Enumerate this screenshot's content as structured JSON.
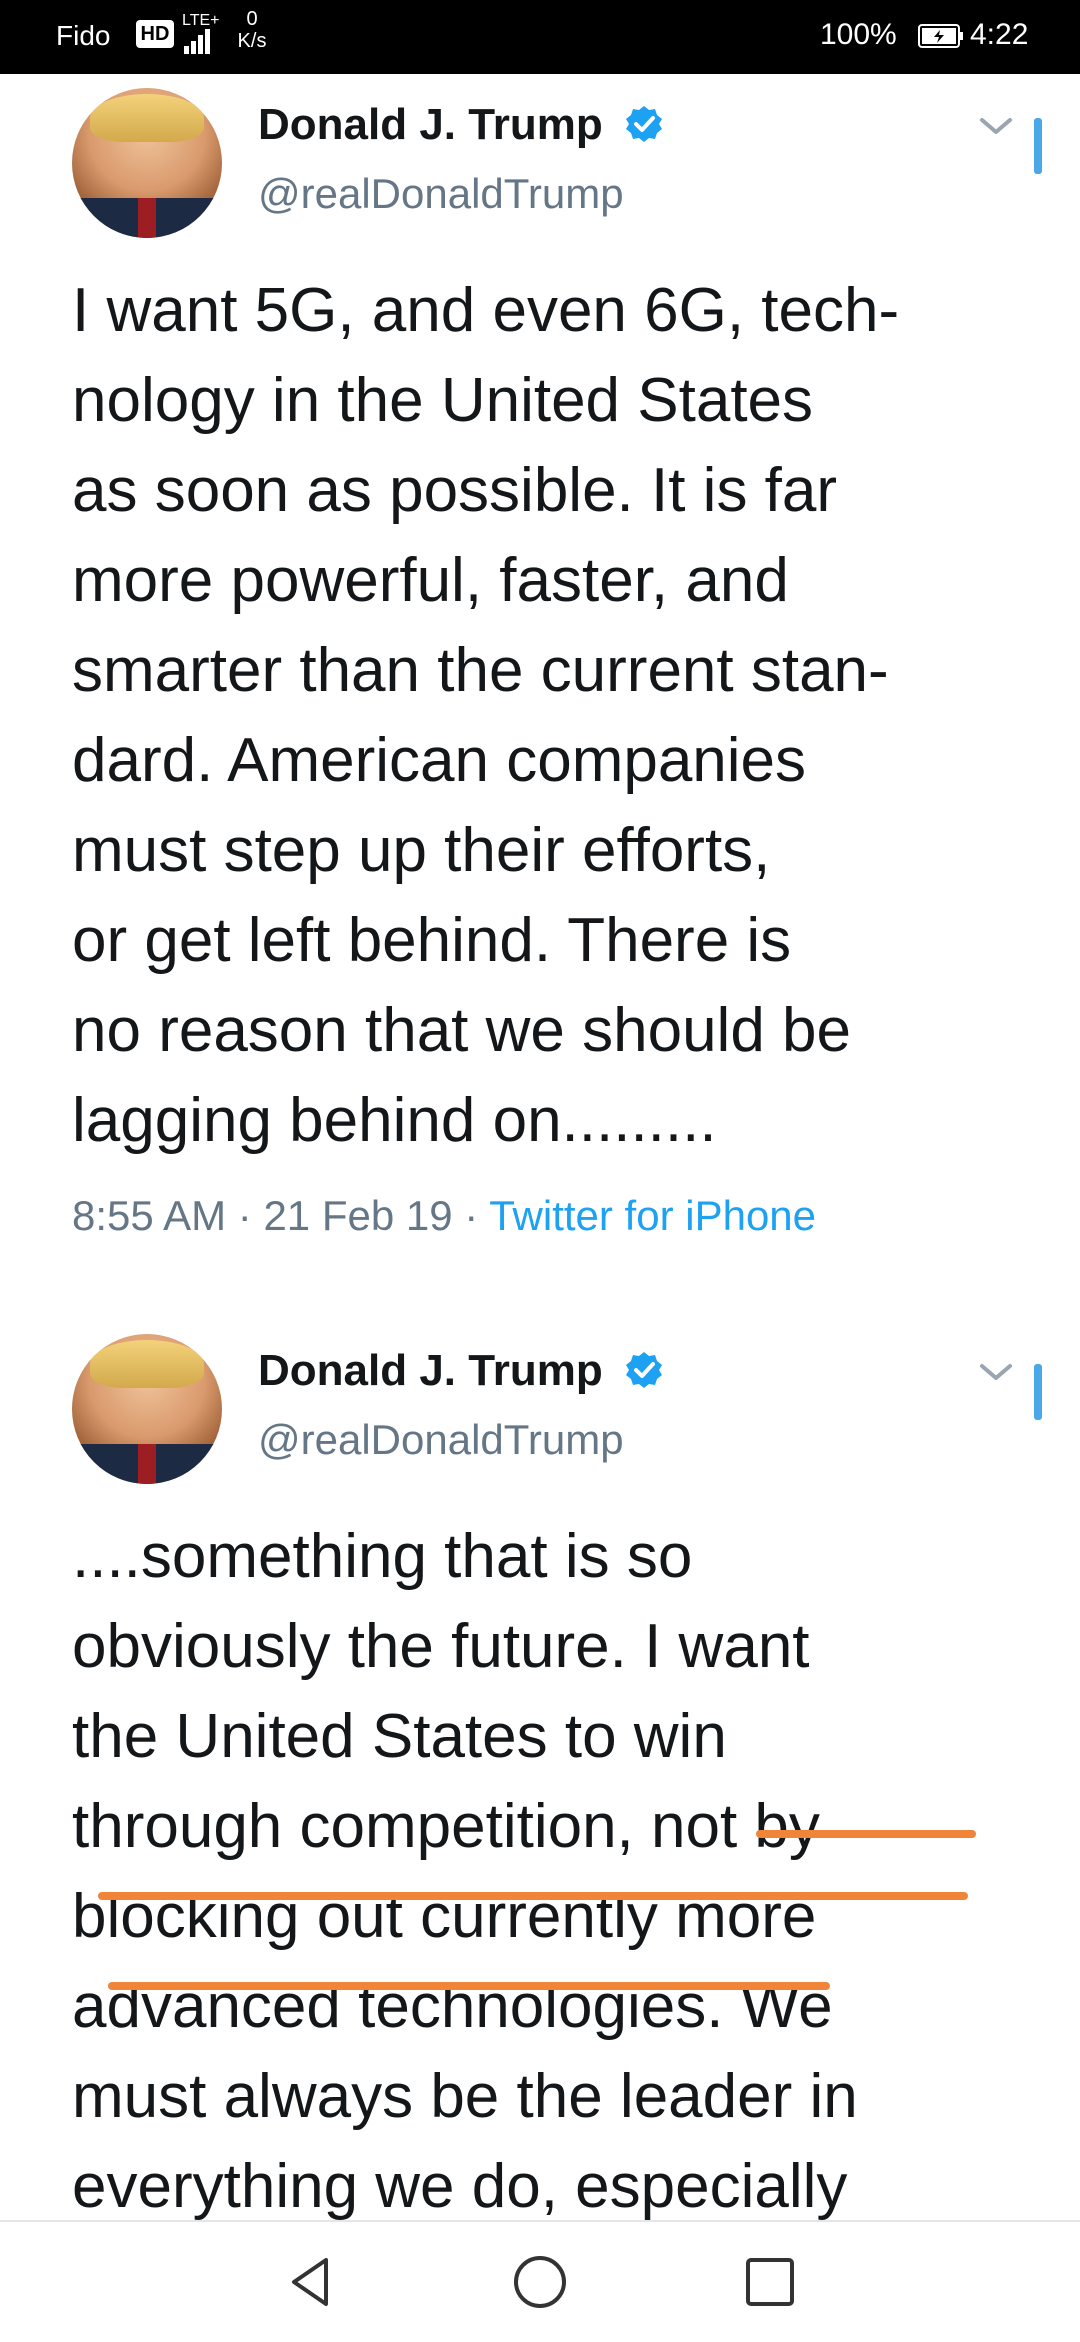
{
  "status_bar": {
    "carrier": "Fido",
    "hd_badge": "HD",
    "network": "LTE+",
    "speed_value": "0",
    "speed_unit": "K/s",
    "battery_percent": "100%",
    "time": "4:22",
    "icons": [
      "hd-icon",
      "signal-icon",
      "battery-icon"
    ]
  },
  "tweets": [
    {
      "author": "Donald J. Trump",
      "handle": "@realDonaldTrump",
      "verified": true,
      "text": "I want 5G, and even 6G, tech-\nnology in the United States\nas soon as possible. It is far\nmore powerful, faster, and\nsmarter than the current stan-\ndard. American companies\nmust step up their efforts,\nor get left behind. There is\nno reason that we should be\nlagging behind on.........",
      "time": "8:55 AM",
      "date": "21 Feb 19",
      "source": "Twitter for iPhone",
      "separator": "·"
    },
    {
      "author": "Donald J. Trump",
      "handle": "@realDonaldTrump",
      "verified": true,
      "text": "....something that is so\nobviously the future. I want\nthe United States to win\nthrough competition, not by\nblocking out currently more\nadvanced technologies. We\nmust always be the leader in\neverything we do, especially"
    }
  ],
  "colors": {
    "verified": "#1da1f2",
    "source_link": "#1da1f2",
    "secondary_text": "#657786",
    "annotation_underline": "#f0853a"
  },
  "nav_bar": {
    "icons": [
      "back-icon",
      "home-icon",
      "recents-icon"
    ]
  }
}
